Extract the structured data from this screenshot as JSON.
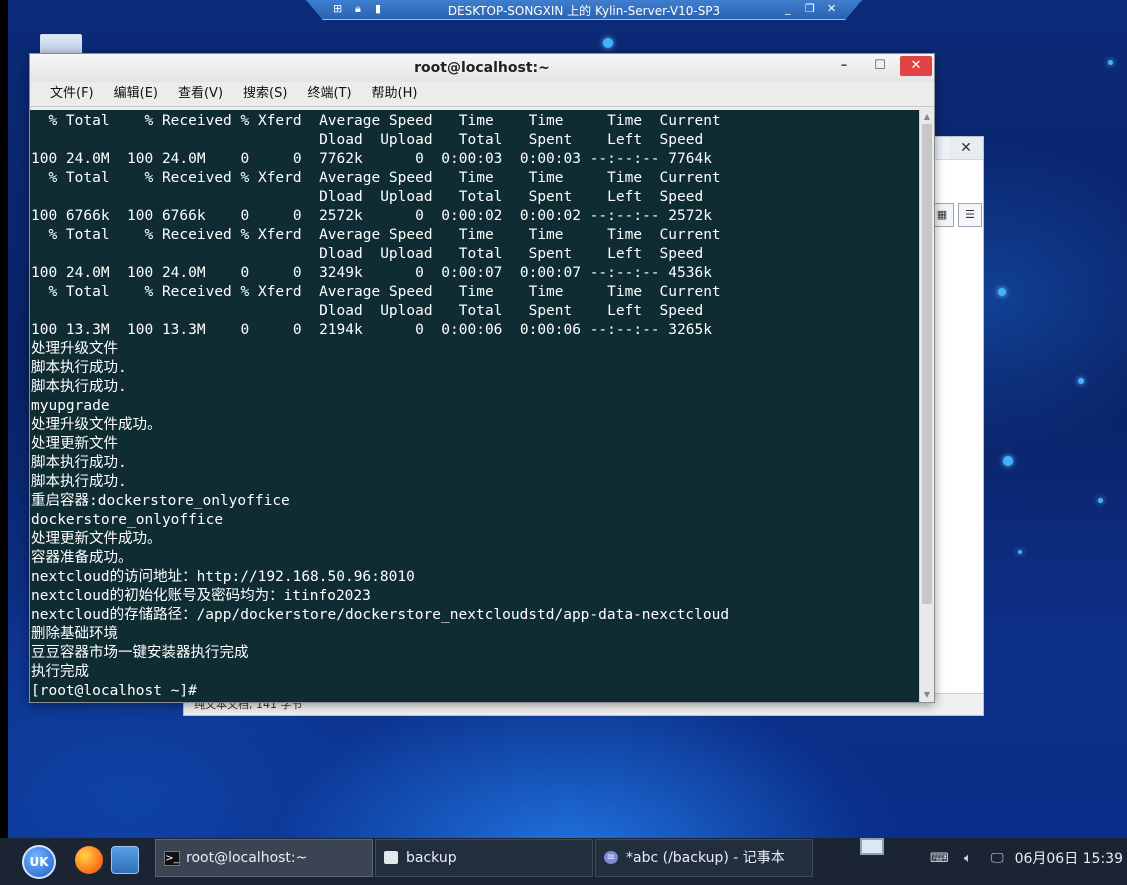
{
  "rdp_bar": {
    "title": "DESKTOP-SONGXIN 上的 Kylin-Server-V10-SP3"
  },
  "terminal": {
    "title": "root@localhost:~",
    "menu": [
      "文件(F)",
      "编辑(E)",
      "查看(V)",
      "搜索(S)",
      "终端(T)",
      "帮助(H)"
    ],
    "lines": [
      "  % Total    % Received % Xferd  Average Speed   Time    Time     Time  Current",
      "                                 Dload  Upload   Total   Spent    Left  Speed",
      "100 24.0M  100 24.0M    0     0  7762k      0  0:00:03  0:00:03 --:--:-- 7764k",
      "  % Total    % Received % Xferd  Average Speed   Time    Time     Time  Current",
      "                                 Dload  Upload   Total   Spent    Left  Speed",
      "100 6766k  100 6766k    0     0  2572k      0  0:00:02  0:00:02 --:--:-- 2572k",
      "  % Total    % Received % Xferd  Average Speed   Time    Time     Time  Current",
      "                                 Dload  Upload   Total   Spent    Left  Speed",
      "100 24.0M  100 24.0M    0     0  3249k      0  0:00:07  0:00:07 --:--:-- 4536k",
      "  % Total    % Received % Xferd  Average Speed   Time    Time     Time  Current",
      "                                 Dload  Upload   Total   Spent    Left  Speed",
      "100 13.3M  100 13.3M    0     0  2194k      0  0:00:06  0:00:06 --:--:-- 3265k",
      "处理升级文件",
      "脚本执行成功.",
      "脚本执行成功.",
      "myupgrade",
      "处理升级文件成功。",
      "处理更新文件",
      "脚本执行成功.",
      "脚本执行成功.",
      "重启容器:dockerstore_onlyoffice",
      "dockerstore_onlyoffice",
      "处理更新文件成功。",
      "容器准备成功。",
      "nextcloud的访问地址：http://192.168.50.96:8010",
      "nextcloud的初始化账号及密码均为：itinfo2023",
      "nextcloud的存储路径：/app/dockerstore/dockerstore_nextcloudstd/app-data-nexctcloud",
      "删除基础环境",
      "豆豆容器市场一键安装器执行完成",
      "执行完成",
      "[root@localhost ~]#"
    ]
  },
  "background_window": {
    "status_text": "纯文本文档, 141 字节"
  },
  "taskbar": {
    "tasks": [
      {
        "label": "root@localhost:~",
        "icon": "terminal-icon"
      },
      {
        "label": "backup",
        "icon": "folder-icon"
      },
      {
        "label": "*abc (/backup) - 记事本",
        "icon": "text-editor-icon"
      }
    ],
    "clock": "06月06日 15:39"
  },
  "colors": {
    "terminal_bg": "#0f2c33",
    "close_button": "#e04343",
    "taskbar_bg": "#1b2433"
  }
}
